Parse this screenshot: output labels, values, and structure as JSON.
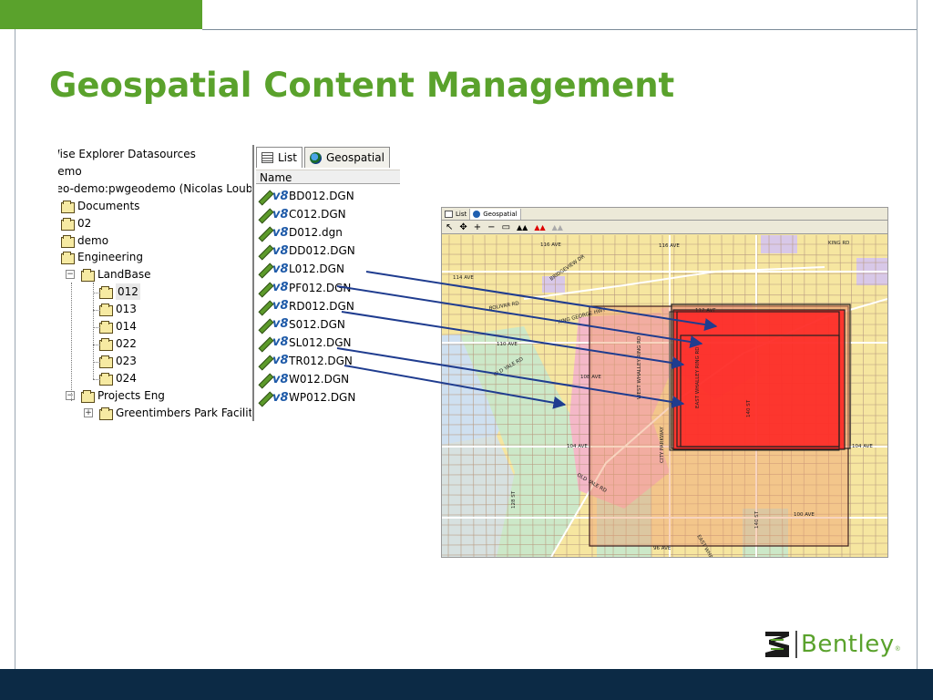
{
  "slide": {
    "title": "Geospatial Content Management",
    "brand_color": "#5aa22c",
    "footer_color": "#0c2a45",
    "logo_text": "Bentley",
    "logo_registered": "®"
  },
  "tree": {
    "items": [
      {
        "label": "Wise Explorer Datasources",
        "icon": "datasources-icon"
      },
      {
        "label": "Demo",
        "icon": "server-icon"
      },
      {
        "label": "geo-demo:pwgeodemo (Nicolas Loubie",
        "icon": "datasource-icon"
      },
      {
        "label": "Documents",
        "icon": "documents-icon"
      },
      {
        "label": "02",
        "icon": "folder-icon"
      },
      {
        "label": "demo",
        "icon": "folder-icon"
      },
      {
        "label": "Engineering",
        "icon": "folder-icon"
      },
      {
        "label": "LandBase",
        "icon": "folder-icon",
        "expander": "⊟"
      },
      {
        "label": "012",
        "icon": "folder-icon",
        "selected": true
      },
      {
        "label": "013",
        "icon": "folder-icon"
      },
      {
        "label": "014",
        "icon": "folder-icon"
      },
      {
        "label": "022",
        "icon": "folder-icon"
      },
      {
        "label": "023",
        "icon": "folder-icon"
      },
      {
        "label": "024",
        "icon": "folder-icon"
      },
      {
        "label": "Projects Eng",
        "icon": "folder-icon",
        "expander": "⊟"
      },
      {
        "label": "Greentimbers Park Faciliti",
        "icon": "folder-icon",
        "expander": "⊞"
      }
    ]
  },
  "file_panel": {
    "tabs": [
      {
        "label": "List",
        "icon": "list-icon",
        "active": true
      },
      {
        "label": "Geospatial",
        "icon": "globe-icon",
        "active": false
      }
    ],
    "column_header": "Name",
    "files": [
      "BD012.DGN",
      "C012.DGN",
      "D012.dgn",
      "DD012.DGN",
      "L012.DGN",
      "PF012.DGN",
      "RD012.DGN",
      "S012.DGN",
      "SL012.DGN",
      "TR012.DGN",
      "W012.DGN",
      "WP012.DGN"
    ]
  },
  "map": {
    "tabs": [
      "List",
      "Geospatial"
    ],
    "toolbar_icons": [
      "select-arrow-icon",
      "pan-icon",
      "zoom-in-icon",
      "zoom-out-icon",
      "zoom-box-icon",
      "terrain-icon",
      "terrain-red-icon",
      "terrain-grey-icon"
    ],
    "street_labels": [
      "116 AVE",
      "116 AVE",
      "KING RD",
      "BRIDGEVIEW DR",
      "114 AVE",
      "KING GEORGE HWY",
      "BOLIVAR RD",
      "112 AVE",
      "110 AVE",
      "OLD YALE RD",
      "108 AVE",
      "WEST WHALLEY RING RD",
      "EAST WHALLEY RING RD",
      "140 ST",
      "104 AVE",
      "104 AVE",
      "CITY PARKWAY",
      "OLD YALE RD",
      "100 AVE",
      "96 AVE",
      "128 ST",
      "140 ST",
      "EAST WHALLEY"
    ],
    "colors": {
      "base": "#f6e6a0",
      "pink": "#f4b8c8",
      "green": "#cce8c8",
      "blue": "#cfe0f0",
      "lavender": "#d8c8e8",
      "extent_red": "#ff2020",
      "extent_salmon": "#f0a070",
      "arrow": "#1f3c8f"
    }
  }
}
